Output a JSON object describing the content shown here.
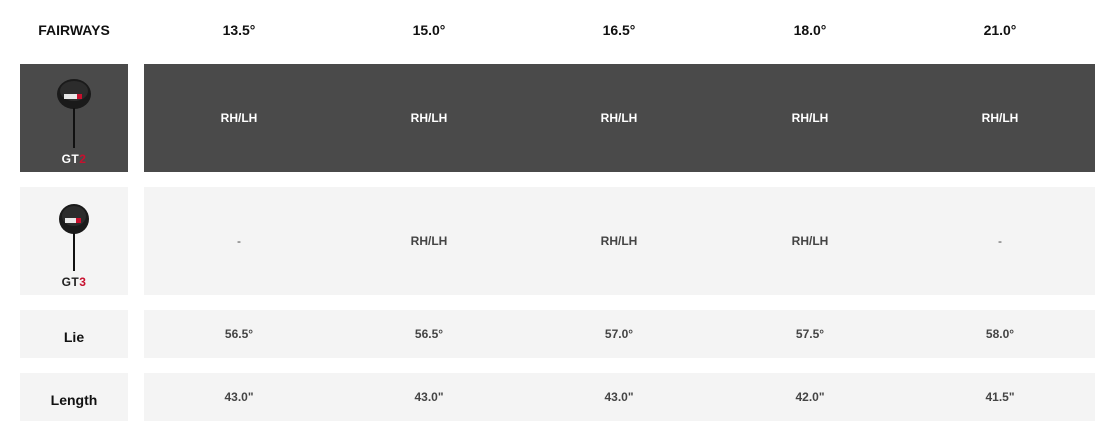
{
  "header": {
    "title": "FAIRWAYS",
    "lofts": [
      "13.5°",
      "15.0°",
      "16.5°",
      "18.0°",
      "21.0°"
    ]
  },
  "rows": {
    "gt2": {
      "name_prefix": "GT",
      "name_suffix": "2",
      "values": [
        "RH/LH",
        "RH/LH",
        "RH/LH",
        "RH/LH",
        "RH/LH"
      ]
    },
    "gt3": {
      "name_prefix": "GT",
      "name_suffix": "3",
      "values": [
        "-",
        "RH/LH",
        "RH/LH",
        "RH/LH",
        "-"
      ]
    },
    "lie": {
      "label": "Lie",
      "values": [
        "56.5°",
        "56.5°",
        "57.0°",
        "57.5°",
        "58.0°"
      ]
    },
    "length": {
      "label": "Length",
      "values": [
        "43.0\"",
        "43.0\"",
        "43.0\"",
        "42.0\"",
        "41.5\""
      ]
    }
  },
  "colors": {
    "dark_row": "#4a4a4a",
    "light_row": "#f4f4f4",
    "accent": "#c8102e"
  },
  "icons": {
    "club_image": "fairway-wood-club-icon"
  }
}
